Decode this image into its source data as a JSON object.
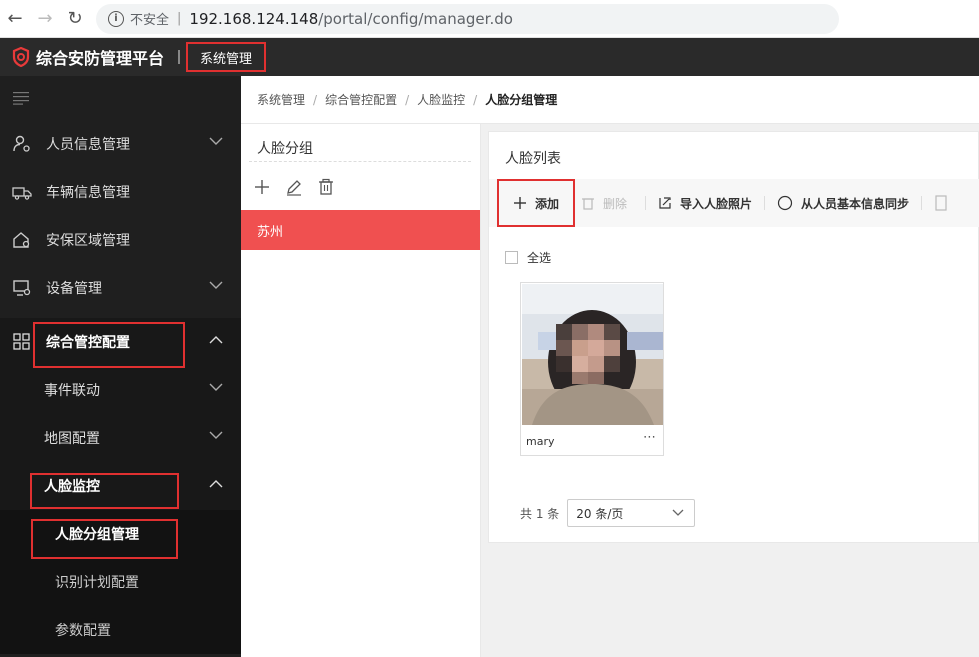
{
  "browser": {
    "insecure_label": "不安全",
    "url_host": "192.168.124.148",
    "url_path": "/portal/config/manager.do"
  },
  "header": {
    "app_title": "综合安防管理平台",
    "system_menu": "系统管理"
  },
  "sidebar": {
    "items": [
      {
        "label": "人员信息管理",
        "icon": "person-gear-icon",
        "expandable": true
      },
      {
        "label": "车辆信息管理",
        "icon": "truck-icon",
        "expandable": false
      },
      {
        "label": "安保区域管理",
        "icon": "house-gear-icon",
        "expandable": false
      },
      {
        "label": "设备管理",
        "icon": "monitor-gear-icon",
        "expandable": true
      },
      {
        "label": "综合管控配置",
        "icon": "grid-icon",
        "expanded": true
      }
    ],
    "sub_items": [
      {
        "label": "事件联动"
      },
      {
        "label": "地图配置"
      },
      {
        "label": "人脸监控"
      }
    ],
    "sub_sub_items": [
      {
        "label": "人脸分组管理"
      },
      {
        "label": "识别计划配置"
      },
      {
        "label": "参数配置"
      }
    ]
  },
  "breadcrumb": [
    "系统管理",
    "综合管控配置",
    "人脸监控",
    "人脸分组管理"
  ],
  "group_panel": {
    "title": "人脸分组",
    "groups": [
      "苏州"
    ]
  },
  "face_panel": {
    "title": "人脸列表",
    "toolbar": {
      "add": "添加",
      "delete": "删除",
      "import": "导入人脸照片",
      "sync": "从人员基本信息同步"
    },
    "select_all": "全选",
    "faces": [
      {
        "name": "mary"
      }
    ],
    "pager": {
      "total": "共 1 条",
      "page_size": "20 条/页"
    }
  },
  "colors": {
    "accent": "#f05050",
    "highlight_box": "#e03030",
    "sidebar_bg": "#1f1f1f",
    "header_bg": "#2a2a2a"
  }
}
